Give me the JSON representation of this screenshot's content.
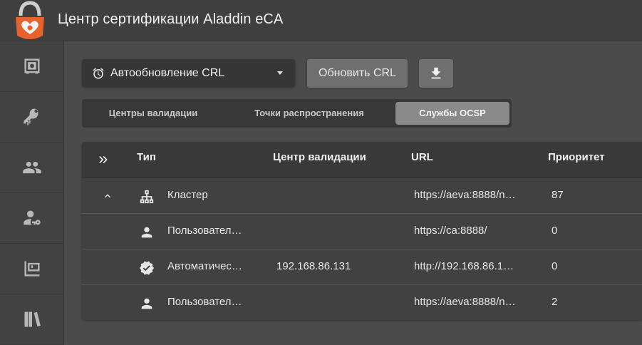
{
  "app": {
    "title": "Центр сертификации Aladdin eCA"
  },
  "sidebar": {
    "items": [
      {
        "icon": "safe-icon"
      },
      {
        "icon": "keys-icon"
      },
      {
        "icon": "users-icon"
      },
      {
        "icon": "user-key-icon"
      },
      {
        "icon": "presentation-icon"
      },
      {
        "icon": "library-icon"
      }
    ]
  },
  "toolbar": {
    "select_label": "Автообновление CRL",
    "refresh_label": "Обновить CRL",
    "download_icon": "download-icon"
  },
  "tabs": [
    {
      "label": "Центры валидации"
    },
    {
      "label": "Точки распространения"
    },
    {
      "label": "Службы OCSP"
    }
  ],
  "table": {
    "headers": [
      "Тип",
      "Центр валидации",
      "URL",
      "Приоритет"
    ],
    "rows": [
      {
        "icon": "cluster-icon",
        "type": "Кластер",
        "center": "",
        "url": "https://aeva:8888/n…",
        "priority": "87"
      },
      {
        "icon": "user-icon",
        "type": "Пользовател…",
        "center": "",
        "url": "https://ca:8888/",
        "priority": "0"
      },
      {
        "icon": "verified-icon",
        "type": "Автоматичес…",
        "center": "192.168.86.131",
        "url": "http://192.168.86.1…",
        "priority": "0"
      },
      {
        "icon": "user-icon",
        "type": "Пользовател…",
        "center": "",
        "url": "https://aeva:8888/n…",
        "priority": "2"
      }
    ]
  },
  "colors": {
    "background": "#4b4b4b",
    "topbar": "#3f3f3f",
    "active_tab": "#8a8a8a",
    "logo_orange": "#e8622b"
  }
}
